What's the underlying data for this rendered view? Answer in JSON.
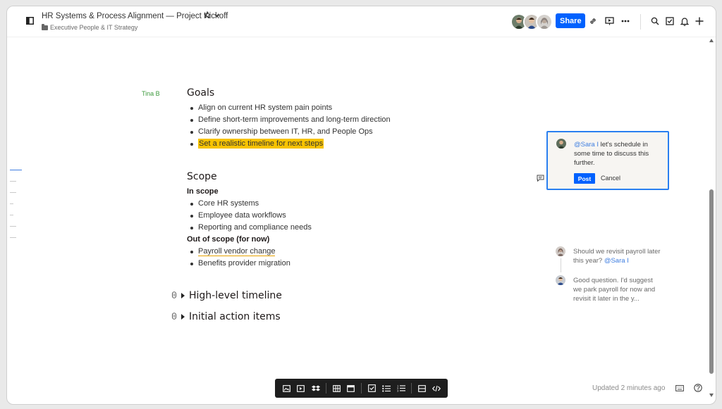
{
  "header": {
    "title": "HR Systems & Process Alignment — Project Kickoff",
    "folder": "Executive People & IT Strategy",
    "share_label": "Share",
    "icons": [
      "sidebar-toggle-icon",
      "star-icon",
      "chevron-down-icon",
      "link-icon",
      "present-icon",
      "more-icon",
      "search-icon",
      "checkbox-icon",
      "bell-icon",
      "plus-icon"
    ]
  },
  "author_tag": "Tina B",
  "goals": {
    "heading": "Goals",
    "items": [
      "Align on current HR system pain points",
      "Define short-term improvements and long-term direction",
      "Clarify ownership between IT, HR, and People Ops",
      "Set a realistic timeline for next steps"
    ]
  },
  "scope": {
    "heading": "Scope",
    "in_label": "In scope",
    "in_items": [
      "Core HR systems",
      "Employee data workflows",
      "Reporting and compliance needs"
    ],
    "out_label": "Out of scope (for now)",
    "out_items": [
      "Payroll vendor change",
      "Benefits provider migration"
    ]
  },
  "toggles": [
    "High-level timeline",
    "Initial action items"
  ],
  "comment_draft": {
    "mention": "@Sara I",
    "text": " let's schedule in some time to discuss this further.",
    "post_label": "Post",
    "cancel_label": "Cancel"
  },
  "thread": [
    {
      "text": "Should we revisit payroll later this year? ",
      "mention": "@Sara I"
    },
    {
      "text": "Good question. I'd suggest we park payroll for now and revisit it later in the y...",
      "mention": ""
    }
  ],
  "toolbar_icons": [
    "image-icon",
    "video-icon",
    "dropbox-icon",
    "table-icon",
    "layout-icon",
    "checklist-icon",
    "bullet-list-icon",
    "numbered-list-icon",
    "divider-icon",
    "code-icon"
  ],
  "footer": {
    "updated": "Updated 2 minutes ago"
  },
  "colors": {
    "accent": "#0061fe",
    "highlight": "#f7c300",
    "comment_border": "#2a7ff0",
    "author_tag": "#3d9a3d"
  }
}
